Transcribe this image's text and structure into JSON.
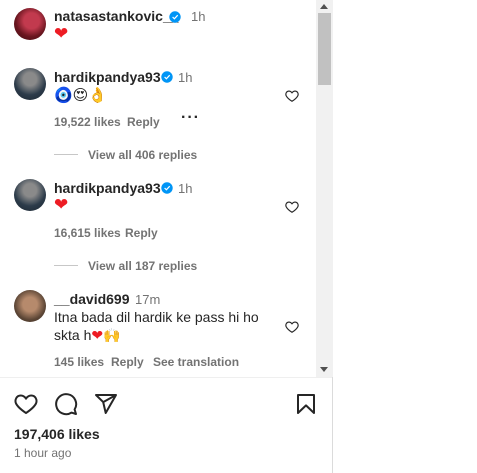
{
  "comments": [
    {
      "username": "natasastankovic__",
      "time": "1h",
      "text": "❤"
    },
    {
      "username": "hardikpandya93",
      "time": "1h",
      "text": "🧿😍👌",
      "likes": "19,522 likes",
      "reply": "Reply",
      "view_replies": "View all 406 replies"
    },
    {
      "username": "hardikpandya93",
      "time": "1h",
      "text": "❤",
      "likes": "16,615 likes",
      "reply": "Reply",
      "view_replies": "View all 187 replies"
    },
    {
      "username": "__david699",
      "time": "17m",
      "text_line1": "Itna bada dil hardik ke pass hi ho",
      "text_line2": "skta h",
      "text_line2_emoji": "❤🙌",
      "likes": "145 likes",
      "reply": "Reply",
      "translation": "See translation"
    }
  ],
  "post": {
    "likes": "197,406 likes",
    "time_ago": "1 hour ago"
  },
  "icons": {
    "like": "heart-icon",
    "comment": "comment-icon",
    "share": "paper-plane-icon",
    "save": "bookmark-icon",
    "verified": "verified-badge-icon",
    "more": "more-options-icon"
  },
  "colors": {
    "verified_blue": "#0095f6",
    "text_primary": "#262626",
    "text_secondary": "#737373",
    "heart_red": "#ed1c24"
  }
}
